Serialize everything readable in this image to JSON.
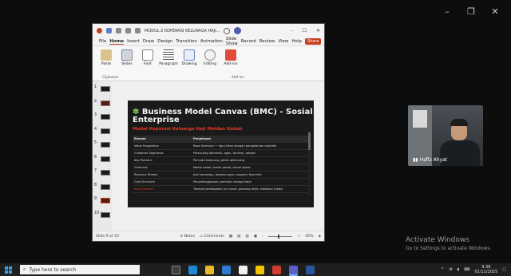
{
  "outer_window": {
    "controls": [
      "–",
      "❐",
      "✕"
    ]
  },
  "ppt": {
    "doc_title": "MODUL-2 KOPERASI KELUARGA HAJI...",
    "title_controls": [
      "–",
      "☐",
      "✕"
    ],
    "menu": [
      "File",
      "Home",
      "Insert",
      "Draw",
      "Design",
      "Transition",
      "Animation",
      "Slide Show",
      "Record",
      "Review",
      "View",
      "Help"
    ],
    "share_label": "Share",
    "ribbon": {
      "buttons": [
        "Paste",
        "Slides",
        "Font",
        "Paragraph",
        "Drawing",
        "Editing",
        "Add-ins"
      ],
      "groups": [
        "Clipboard",
        "Add-ins"
      ]
    },
    "slide_numbers": [
      "1",
      "2",
      "3",
      "4",
      "5",
      "6",
      "7",
      "8",
      "9",
      "10"
    ],
    "slide": {
      "title": "Business Model Canvas (BMC) - Sosial Enterprise",
      "title_icon": "puzzle-icon",
      "subtitle": "Model Koperasi Keluarga Haji Meidan Kodah",
      "table_headers": [
        "Elemen",
        "Penjelasan"
      ],
      "table_rows": [
        [
          "Value Proposition",
          "Rasa Harmony + Agro Desa dengan pengalaman autentik"
        ],
        [
          "Customer Segments",
          "Pelancong domestik, agen, tourism, pelajar"
        ],
        [
          "Key Partners",
          "Pemuda kampung, pihak pelancong"
        ],
        [
          "Channels",
          "Media sosial, laman portal, travel agent"
        ],
        [
          "Revenue Stream",
          "Jual homestay, bawaan agro, program komuniti"
        ],
        [
          "Cost Structure",
          "Penyelenggaraan premisai, tenaga kerja"
        ],
        [
          "Social Impact",
          "Tambah pendapatan isi rumah, peluang kerja, kekalkan tradisi"
        ]
      ]
    },
    "status": {
      "slide_counter": "Slide 9 of 10",
      "notes": "Notes",
      "comments": "Comments",
      "zoom": "40%"
    }
  },
  "camera": {
    "participant_name": "Hafiz Ahyat"
  },
  "activation": {
    "title": "Activate Windows",
    "subtitle": "Go to Settings to activate Windows."
  },
  "taskbar": {
    "search_placeholder": "Type here to search",
    "time": "9:38",
    "date": "01/11/2025"
  },
  "colors": {
    "accent_red": "#e23a25",
    "ppt_orange": "#c43e1c"
  }
}
